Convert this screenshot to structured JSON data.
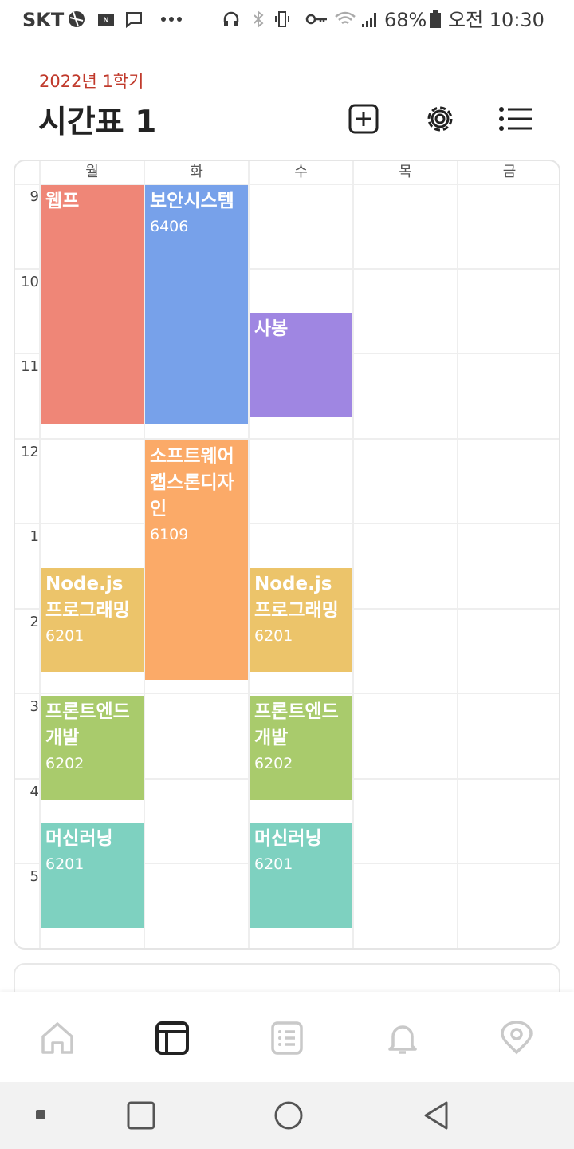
{
  "status_bar": {
    "carrier": "SKT",
    "battery": "68%",
    "time": "오전 10:30"
  },
  "header": {
    "semester": "2022년 1학기",
    "title": "시간표 1",
    "add_icon": "plus-square-icon",
    "settings_icon": "gear-icon",
    "list_icon": "list-icon"
  },
  "timetable": {
    "days": [
      "월",
      "화",
      "수",
      "목",
      "금"
    ],
    "hours": [
      "9",
      "10",
      "11",
      "12",
      "1",
      "2",
      "3",
      "4",
      "5"
    ],
    "courses": [
      {
        "name": "웹프",
        "room": "",
        "color": "#EF8677"
      },
      {
        "name": "보안시스템",
        "room": "6406",
        "color": "#77A1EA"
      },
      {
        "name": "사봉",
        "room": "",
        "color": "#9F86E2"
      },
      {
        "name": "소프트웨어캡스톤디자인",
        "room": "6109",
        "color": "#FBAA68"
      },
      {
        "name": "Node.js프로그래밍",
        "room": "6201",
        "color": "#ECC46A"
      },
      {
        "name": "Node.js프로그래밍",
        "room": "6201",
        "color": "#ECC46A"
      },
      {
        "name": "프론트엔드개발",
        "room": "6202",
        "color": "#A9CB6C"
      },
      {
        "name": "프론트엔드개발",
        "room": "6202",
        "color": "#A9CB6C"
      },
      {
        "name": "머신러닝",
        "room": "6201",
        "color": "#7ED1C0"
      },
      {
        "name": "머신러닝",
        "room": "6201",
        "color": "#7ED1C0"
      }
    ]
  },
  "bottom_nav": [
    "home-icon",
    "timetable-icon",
    "board-icon",
    "bell-icon",
    "campus-pick-icon"
  ],
  "system_nav": [
    "recent-apps-icon",
    "home-square-icon",
    "home-circle-icon",
    "back-icon"
  ],
  "colors": {
    "accent": "#c0392b",
    "text": "#222222",
    "grid": "#eeeeee"
  }
}
